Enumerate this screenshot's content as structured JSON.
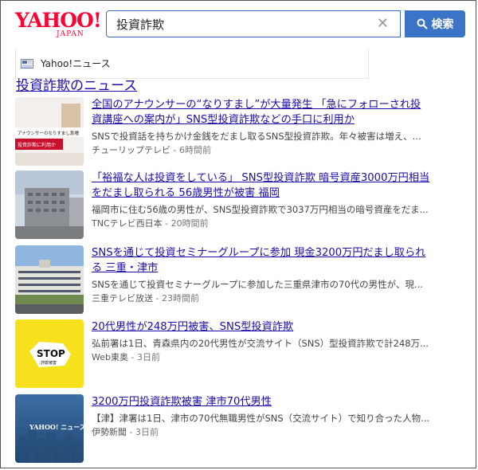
{
  "logo": {
    "main": "YAHOO!",
    "sub": "JAPAN"
  },
  "search": {
    "query": "投資詐欺",
    "button_label": "検索"
  },
  "source_tab": {
    "label": "Yahoo!ニュース"
  },
  "section_title": "投資詐欺のニュース",
  "articles": [
    {
      "headline_lines": [
        "全国のアナウンサーの“なりすまし”が大量発生 「急にフォローされ投",
        "資講座への案内が」SNS型投資詐欺などの手口に利用か"
      ],
      "snippet": "SNSで投資話を持ちかけ金銭をだまし取るSNS型投資詐欺。年々被害は増え、...",
      "source": "チューリップテレビ",
      "time": "6時間前",
      "thumb_text": [
        "アナウンサーのなりすまし急増",
        "投資詐欺に利用か"
      ]
    },
    {
      "headline_lines": [
        "「裕福な人は投資をしている」 SNS型投資詐欺 暗号資産3000万円相当",
        "をだまし取られる 56歳男性が被害 福岡"
      ],
      "snippet": "福岡市に住む56歳の男性が、SNS型投資詐欺で3037万円相当の暗号資産をだま...",
      "source": "TNCテレビ西日本",
      "time": "20時間前",
      "thumb_text": []
    },
    {
      "headline_lines": [
        "SNSを通じて投資セミナーグループに参加 現金3200万円だまし取られ",
        "る 三重・津市"
      ],
      "snippet": "SNSを通じて投資セミナーグループに参加した三重県津市の70代の男性が、現...",
      "source": "三重テレビ放送",
      "time": "23時間前",
      "thumb_text": []
    },
    {
      "headline_lines": [
        "20代男性が248万円被害、SNS型投資詐欺"
      ],
      "snippet": "弘前署は1日、青森県内の20代男性が交流サイト（SNS）型投資詐欺で計248万...",
      "source": "Web東奥",
      "time": "3日前",
      "thumb_text": [
        "STOP",
        "詐欺被害"
      ]
    },
    {
      "headline_lines": [
        "3200万円投資詐欺被害 津市70代男性"
      ],
      "snippet": "【津】津署は1日、津市の70代無職男性がSNS（交流サイト）で知り合った人物...",
      "source": "伊勢新聞",
      "time": "3日前",
      "thumb_text": [
        "YAHOO! ニュース"
      ]
    }
  ],
  "meta_separator": " - ",
  "colors": {
    "link": "#1a0dab",
    "brand_red": "#ff0033",
    "search_button": "#3b73c6"
  }
}
